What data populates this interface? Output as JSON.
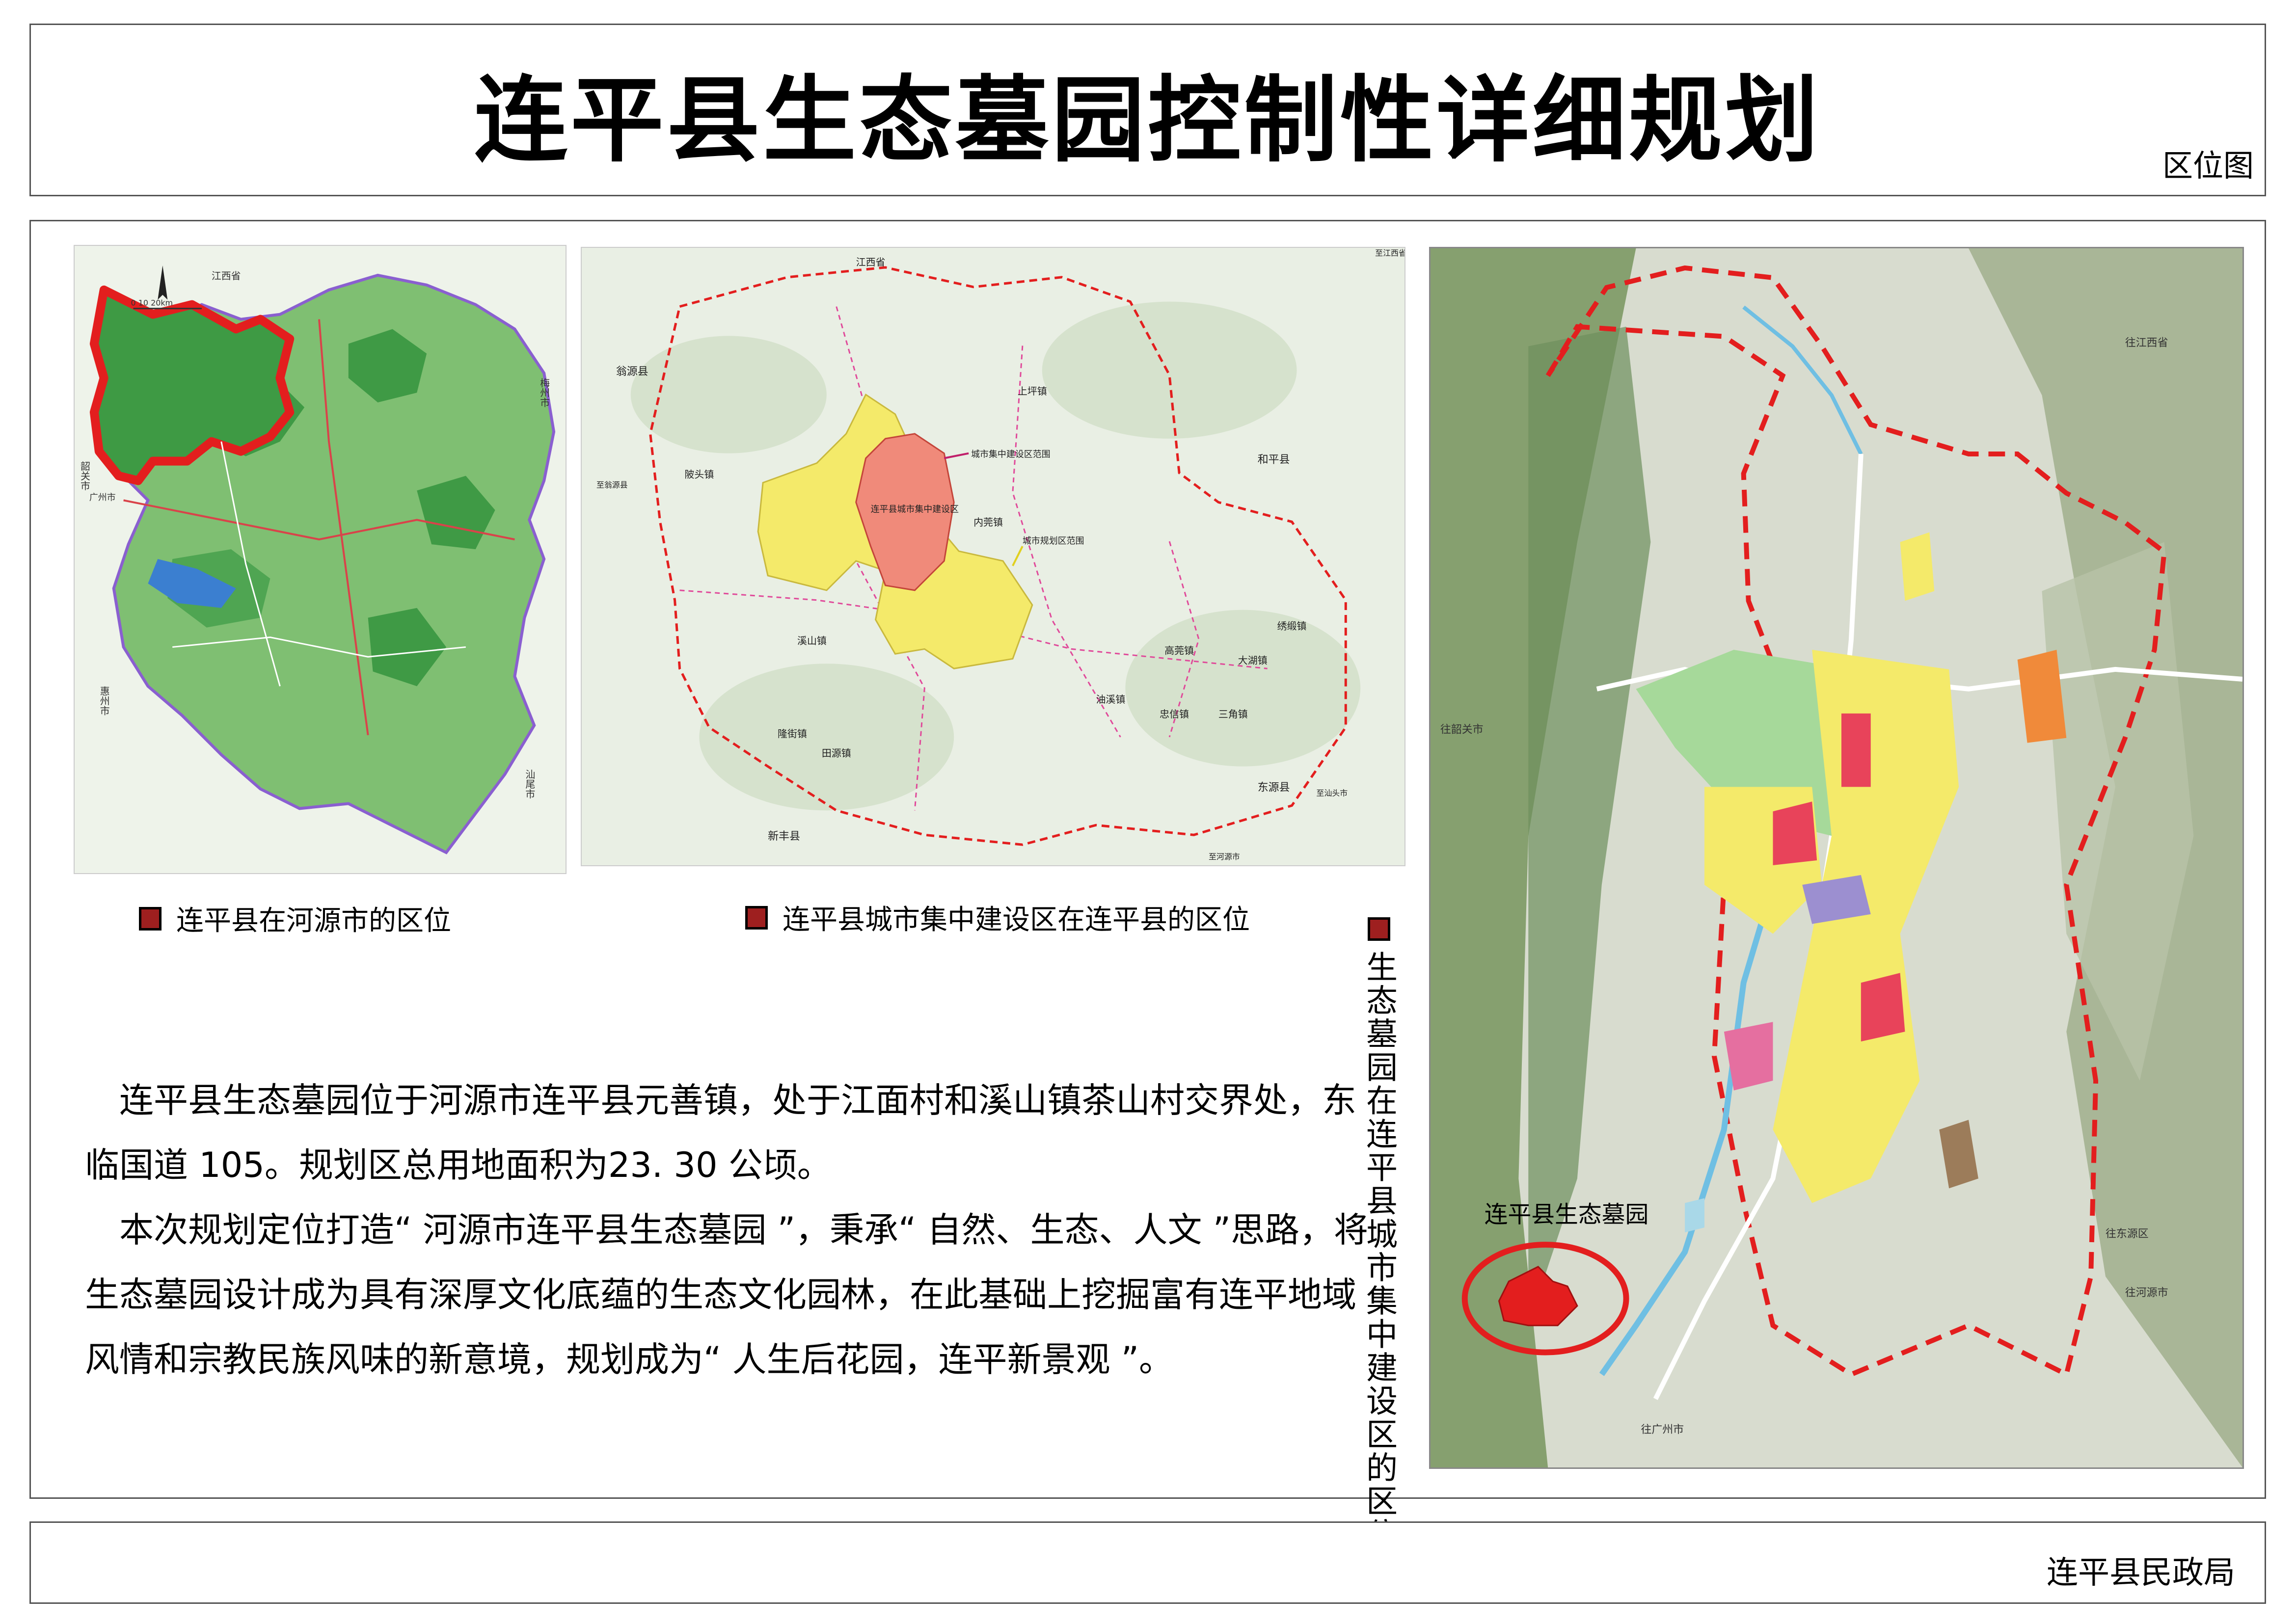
{
  "header": {
    "title": "连平县生态墓园控制性详细规划",
    "subtitle": "区位图"
  },
  "legends": {
    "map1": "连平县在河源市的区位",
    "map2": "连平县城市集中建设区在连平县的区位",
    "map3": "生态墓园在连平县城市集中建设区的区位"
  },
  "map1_labels": {
    "jiangxi": "江西省",
    "meizhou": "梅州市",
    "shaoguan": "韶关市",
    "huizhou": "惠州市",
    "guangzhou": "广州市",
    "shanwei": "汕尾市",
    "scale": "0 10 20km"
  },
  "map2_labels": {
    "jiangxi": "江西省",
    "wengyuan": "翁源县",
    "heping": "和平县",
    "dongyuan": "东源县",
    "xinfeng": "新丰县",
    "shangping": "上坪镇",
    "shaotou": "陂头镇",
    "neiguan": "内莞镇",
    "xishan": "溪山镇",
    "longjie": "隆街镇",
    "tianyuan": "田源镇",
    "youxi": "油溪镇",
    "zhongxin": "忠信镇",
    "sanjiao": "三角镇",
    "gaoguan": "高莞镇",
    "dahu": "大湖镇",
    "xiuzhuan": "绣缎镇",
    "center": "连平县城市集中建设区",
    "label_red": "城市集中建设区范围",
    "label_yellow": "城市规划区范围",
    "to_wengyuan": "至翁源县",
    "to_shantou": "至汕头市",
    "to_heyuan": "至河源市",
    "to_jiangxi": "至江西省"
  },
  "map3_labels": {
    "cemetery": "连平县生态墓园",
    "to_jiangxi": "往江西省",
    "to_shaoguan": "往韶关市",
    "to_dongyuan": "往东源区",
    "to_heyuan": "往河源市",
    "to_guangzhou": "往广州市"
  },
  "description": [
    "连平县生态墓园位于河源市连平县元善镇，处于江面村和溪山镇茶山村交界处，东临国道 105。规划区总用地面积为23. 30 公顷。",
    "本次规划定位打造“ 河源市连平县生态墓园 ”，秉承“ 自然、生态、人文 ”思路，将生态墓园设计成为具有深厚文化底蕴的生态文化园林，在此基础上挖掘富有连平地域风情和宗教民族风味的新意境，规划成为“ 人生后花园，连平新景观 ”。"
  ],
  "footer": {
    "org": "连平县民政局"
  },
  "colors": {
    "boundary": "#e31e1e",
    "central_area": "#f08a7a",
    "planning_area": "#f4ea6a",
    "legend_swatch": "#9e1f1f"
  }
}
